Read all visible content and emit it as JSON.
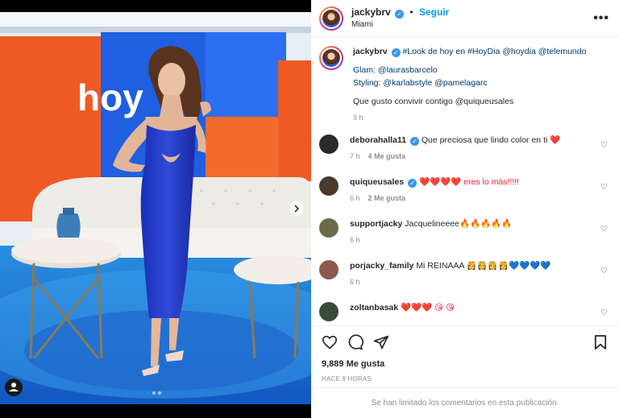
{
  "post": {
    "username": "jackybrv",
    "verified_badge": "✓",
    "separator": "•",
    "follow_label": "Seguir",
    "location": "Miami",
    "more_label": "•••",
    "image_logo_text": "hoy",
    "carousel_dots": 3
  },
  "caption": {
    "username": "jackybrv",
    "text": "#Look de hoy en #HoyDia @hoydia @telemundo",
    "line2": "Glam: @laurasbarcelo",
    "line3": "Styling: @karlabstyle @pamelagarc",
    "line4": "Que gusto convivir contigo @quiqueusales",
    "time": "9 h"
  },
  "comments": [
    {
      "username": "deborahalla11",
      "verified": true,
      "text": "Que preciosa que lindo color en ti",
      "emoji": "❤️",
      "time": "7 h",
      "likes": "4 Me gusta",
      "avatar_color": "#2a2a2a"
    },
    {
      "username": "quiqueusales",
      "verified": true,
      "text": "❤️❤️❤️❤️ eres lo más!!!!!",
      "emoji": "",
      "time": "6 h",
      "likes": "2 Me gusta",
      "avatar_color": "#4a3a2c"
    },
    {
      "username": "supportjacky",
      "verified": false,
      "text": "Jacquelineeee🔥🔥🔥🔥🔥",
      "emoji": "",
      "time": "6 h",
      "likes": "",
      "avatar_color": "#6b6a4a"
    },
    {
      "username": "porjacky_family",
      "verified": false,
      "text": "Mi REINAAA 👸👸👸👸💙💙💙💙",
      "emoji": "",
      "time": "6 h",
      "likes": "",
      "avatar_color": "#8a5a4a"
    },
    {
      "username": "zoltanbasak",
      "verified": false,
      "text": "❤️❤️❤️ 😘 😘",
      "emoji": "",
      "time": "",
      "likes": "",
      "avatar_color": "#3a4a3a"
    }
  ],
  "actions": {
    "like_icon": "heart-icon",
    "comment_icon": "comment-icon",
    "share_icon": "share-icon",
    "save_icon": "bookmark-icon"
  },
  "likes_count": "9,889 Me gusta",
  "posted_ago": "HACE 9 HORAS",
  "comments_limited": "Se han limitado los comentarios en esta publicación."
}
